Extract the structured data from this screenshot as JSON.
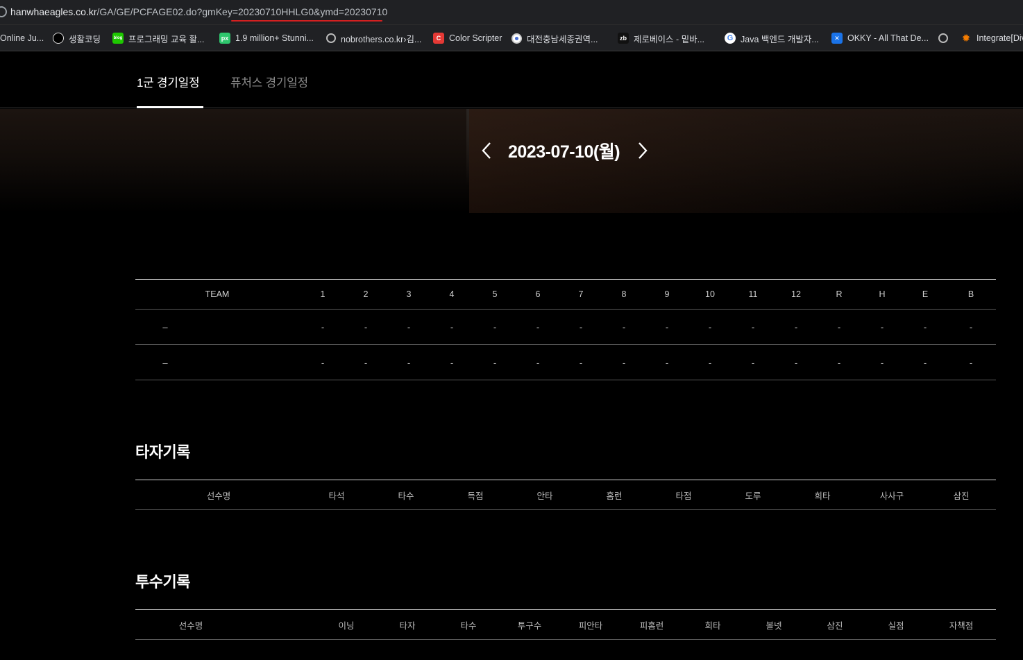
{
  "browser": {
    "url_host": "hanwhaeagles.co.kr",
    "url_path": "/GA/GE/PCFAGE02.do?gmKey=20230710HHLG0&ymd=20230710",
    "bookmarks": [
      {
        "label": "Online Ju...",
        "icon": "page-icon"
      },
      {
        "label": "생활코딩",
        "icon": "circle-icon"
      },
      {
        "label": "프로그래밍 교육 활...",
        "icon": "blog-icon"
      },
      {
        "label": "1.9 million+ Stunni...",
        "icon": "px-icon"
      },
      {
        "label": "nobrothers.co.kr›김...",
        "icon": "globe-icon"
      },
      {
        "label": "Color Scripter",
        "icon": "c-icon"
      },
      {
        "label": "대전충남세종권역...",
        "icon": "target-icon"
      },
      {
        "label": "제로베이스 - 밑바...",
        "icon": "zb-icon"
      },
      {
        "label": "Java 백엔드 개발자...",
        "icon": "google-icon"
      },
      {
        "label": "OKKY - All That De...",
        "icon": "okky-icon"
      },
      {
        "label": "",
        "icon": "globe-icon"
      },
      {
        "label": "Integrate[Div",
        "icon": "gear-icon"
      }
    ]
  },
  "tabs": {
    "first_team": "1군 경기일정",
    "futures": "퓨처스 경기일정"
  },
  "date_nav": {
    "date": "2023-07-10(월)"
  },
  "scoreboard": {
    "headers": [
      "TEAM",
      "1",
      "2",
      "3",
      "4",
      "5",
      "6",
      "7",
      "8",
      "9",
      "10",
      "11",
      "12",
      "R",
      "H",
      "E",
      "B"
    ],
    "rows": [
      [
        "–",
        "-",
        "-",
        "-",
        "-",
        "-",
        "-",
        "-",
        "-",
        "-",
        "-",
        "-",
        "-",
        "-",
        "-",
        "-",
        "-"
      ],
      [
        "–",
        "-",
        "-",
        "-",
        "-",
        "-",
        "-",
        "-",
        "-",
        "-",
        "-",
        "-",
        "-",
        "-",
        "-",
        "-",
        "-"
      ]
    ]
  },
  "batting": {
    "title": "타자기록",
    "headers": [
      "선수명",
      "타석",
      "타수",
      "득점",
      "안타",
      "홈런",
      "타점",
      "도루",
      "희타",
      "사사구",
      "삼진"
    ]
  },
  "pitching": {
    "title": "투수기록",
    "headers": [
      "선수명",
      "이닝",
      "타자",
      "타수",
      "투구수",
      "피안타",
      "피홈런",
      "희타",
      "볼넷",
      "삼진",
      "실점",
      "자책점"
    ]
  },
  "colors": {
    "background": "#000000",
    "chrome": "#202124",
    "url_underline": "#d42020"
  }
}
